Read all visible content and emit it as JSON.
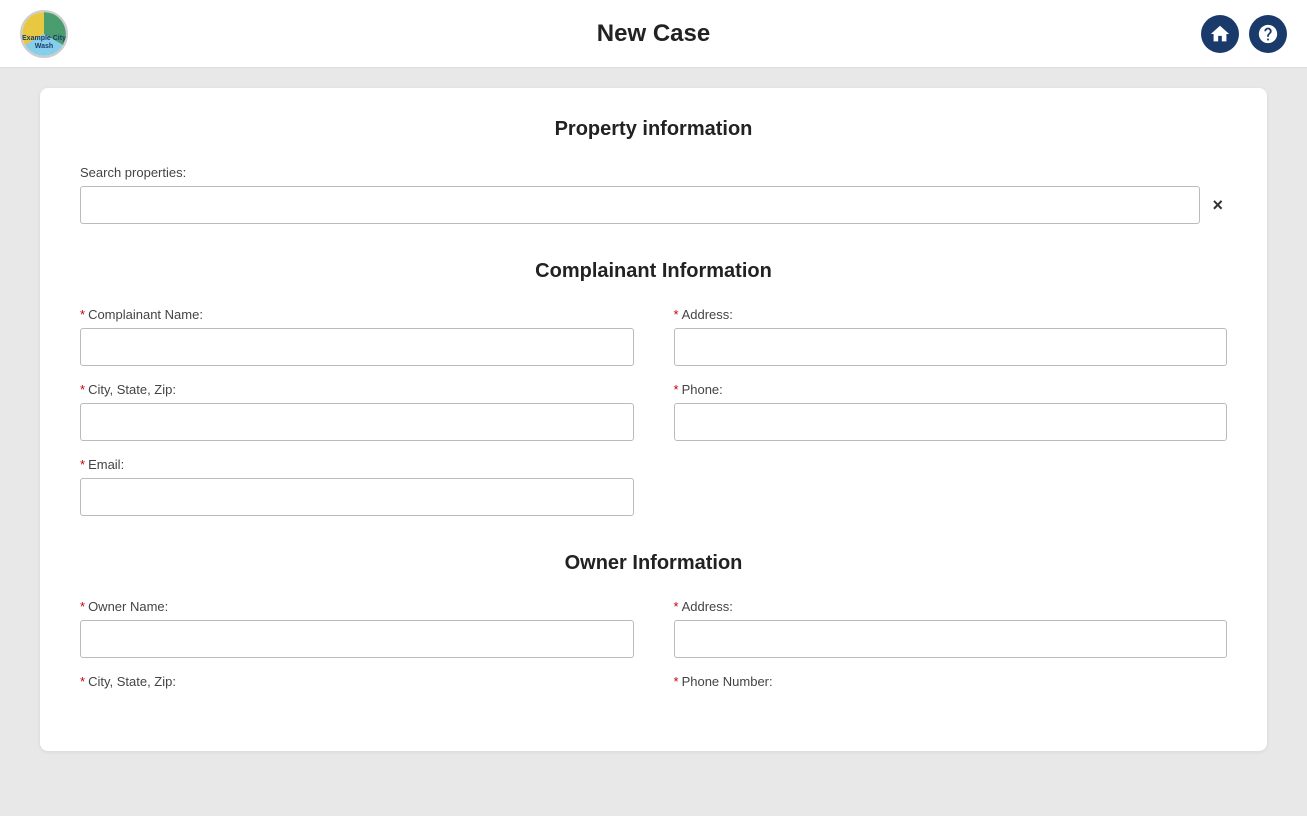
{
  "header": {
    "title": "New Case",
    "logo_alt": "Example City Logo",
    "logo_line1": "Example City",
    "logo_line2": "Wash"
  },
  "property_section": {
    "title": "Property information",
    "search_label": "Search properties:",
    "search_placeholder": "",
    "clear_button": "×"
  },
  "complainant_section": {
    "title": "Complainant Information",
    "fields": [
      {
        "id": "complainant-name",
        "label": "Complainant Name:",
        "required": true,
        "col": "left"
      },
      {
        "id": "address",
        "label": "Address:",
        "required": true,
        "col": "right"
      },
      {
        "id": "city-state-zip",
        "label": "City, State, Zip:",
        "required": true,
        "col": "left"
      },
      {
        "id": "phone",
        "label": "Phone:",
        "required": true,
        "col": "right"
      },
      {
        "id": "email",
        "label": "Email:",
        "required": true,
        "col": "left-only"
      }
    ]
  },
  "owner_section": {
    "title": "Owner Information",
    "fields": [
      {
        "id": "owner-name",
        "label": "Owner Name:",
        "required": true,
        "col": "left"
      },
      {
        "id": "owner-address",
        "label": "Address:",
        "required": true,
        "col": "right"
      },
      {
        "id": "owner-city-state-zip",
        "label": "City, State, Zip:",
        "required": true,
        "col": "left"
      },
      {
        "id": "owner-phone-number",
        "label": "Phone Number:",
        "required": true,
        "col": "right"
      }
    ]
  }
}
